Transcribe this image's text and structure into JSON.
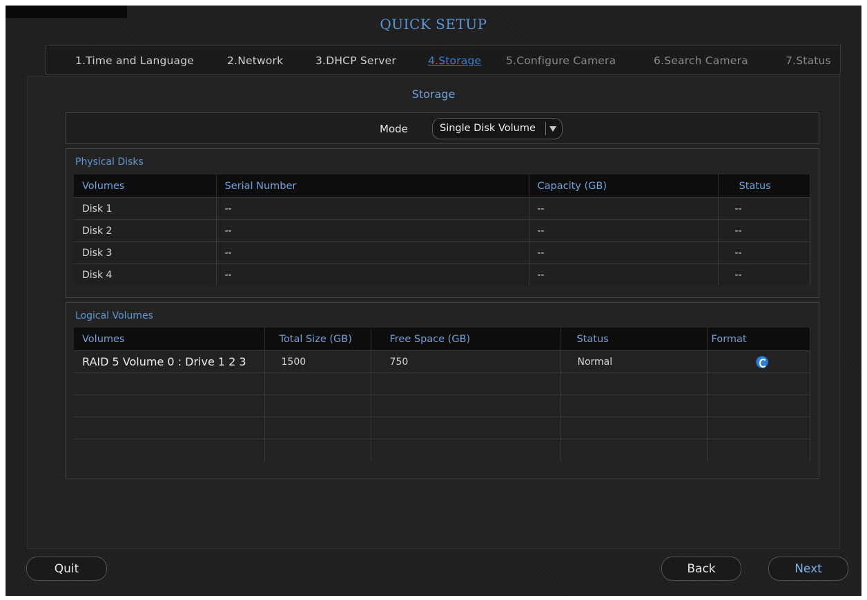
{
  "header": {
    "title": "QUICK SETUP"
  },
  "steps": [
    {
      "label": "1.Time and Language",
      "state": "done"
    },
    {
      "label": "2.Network",
      "state": "done"
    },
    {
      "label": "3.DHCP Server",
      "state": "done"
    },
    {
      "label": "4.Storage",
      "state": "active"
    },
    {
      "label": "5.Configure Camera",
      "state": "pending"
    },
    {
      "label": "6.Search Camera",
      "state": "pending"
    },
    {
      "label": "7.Status",
      "state": "pending"
    }
  ],
  "storage": {
    "title": "Storage",
    "mode_label": "Mode",
    "mode_value": "Single Disk Volume"
  },
  "physical": {
    "title": "Physical Disks",
    "headers": [
      "Volumes",
      "Serial Number",
      "Capacity (GB)",
      "Status"
    ],
    "rows": [
      [
        "Disk 1",
        "--",
        "--",
        "--"
      ],
      [
        "Disk 2",
        "--",
        "--",
        "--"
      ],
      [
        "Disk 3",
        "--",
        "--",
        "--"
      ],
      [
        "Disk 4",
        "--",
        "--",
        "--"
      ]
    ]
  },
  "logical": {
    "title": "Logical Volumes",
    "headers": [
      "Volumes",
      "Total Size (GB)",
      "Free Space (GB)",
      "Status",
      "Format"
    ],
    "rows": [
      [
        "RAID 5 Volume 0 : Drive 1 2 3",
        "1500",
        "750",
        "Normal",
        ""
      ],
      [
        "",
        "",
        "",
        "",
        ""
      ],
      [
        "",
        "",
        "",
        "",
        ""
      ],
      [
        "",
        "",
        "",
        "",
        ""
      ],
      [
        "",
        "",
        "",
        "",
        ""
      ]
    ],
    "format_icon": "format-icon"
  },
  "buttons": {
    "quit": "Quit",
    "back": "Back",
    "next": "Next"
  },
  "colors": {
    "accent": "#5b95d6",
    "format_icon": "#2d7fd8"
  }
}
